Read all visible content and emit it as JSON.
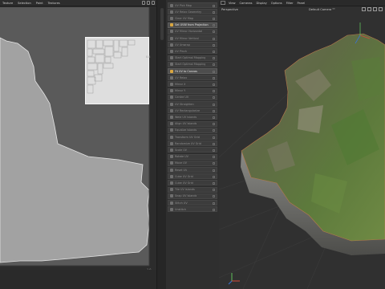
{
  "uv_editor": {
    "menu": [
      "Texture",
      "Selection",
      "Paint",
      "Textures"
    ],
    "tick_x": "1.0",
    "tick_y": "0.8"
  },
  "commands": {
    "items": [
      {
        "label": "UV Pick Map",
        "active": false
      },
      {
        "label": "UV Relax Geometry",
        "active": false
      },
      {
        "label": "Clear UV Map",
        "active": false
      },
      {
        "label": "Set UVW from Projection",
        "active": true
      },
      {
        "label": "UV Mirror Horizontal",
        "active": false
      },
      {
        "label": "UV Mirror Vertical",
        "active": false
      },
      {
        "label": "UV Unwrap",
        "active": false
      },
      {
        "label": "UV Pinch",
        "active": false
      },
      {
        "label": "Start Optimal Mapping",
        "active": false
      },
      {
        "label": "Start Optimal Mapping",
        "active": false
      },
      {
        "label": "Fit UV to Canvas",
        "active": true
      },
      {
        "label": "UV Relax",
        "active": false
      },
      {
        "label": "Mirror X",
        "active": false
      },
      {
        "label": "Mirror Y",
        "active": false
      },
      {
        "label": "Centre UV",
        "active": false
      },
      {
        "label": "UV Straighten",
        "active": false
      },
      {
        "label": "UV Rectangularize",
        "active": false
      },
      {
        "label": "Weld UV Islands",
        "active": false
      },
      {
        "label": "Align UV Islands",
        "active": false
      },
      {
        "label": "Equalize Islands",
        "active": false
      },
      {
        "label": "Transform UV Grid",
        "active": false
      },
      {
        "label": "Randomize UV Grid",
        "active": false
      },
      {
        "label": "Scale UV",
        "active": false
      },
      {
        "label": "Rotate UV",
        "active": false
      },
      {
        "label": "Move UV",
        "active": false
      },
      {
        "label": "Reset UV",
        "active": false
      },
      {
        "label": "Cube UV Grid",
        "active": false
      },
      {
        "label": "Cube UV Grid",
        "active": false
      },
      {
        "label": "Tile UV Islands",
        "active": false
      },
      {
        "label": "Snap UV Islands",
        "active": false
      },
      {
        "label": "Stitch UV",
        "active": false
      },
      {
        "label": "Unstitch",
        "active": false
      }
    ]
  },
  "viewport": {
    "menu": [
      "View",
      "Cameras",
      "Display",
      "Options",
      "Filter",
      "Panel"
    ],
    "label": "Perspective",
    "camera": "Default Camera ⁰⁰",
    "accent": "#d9a640"
  }
}
